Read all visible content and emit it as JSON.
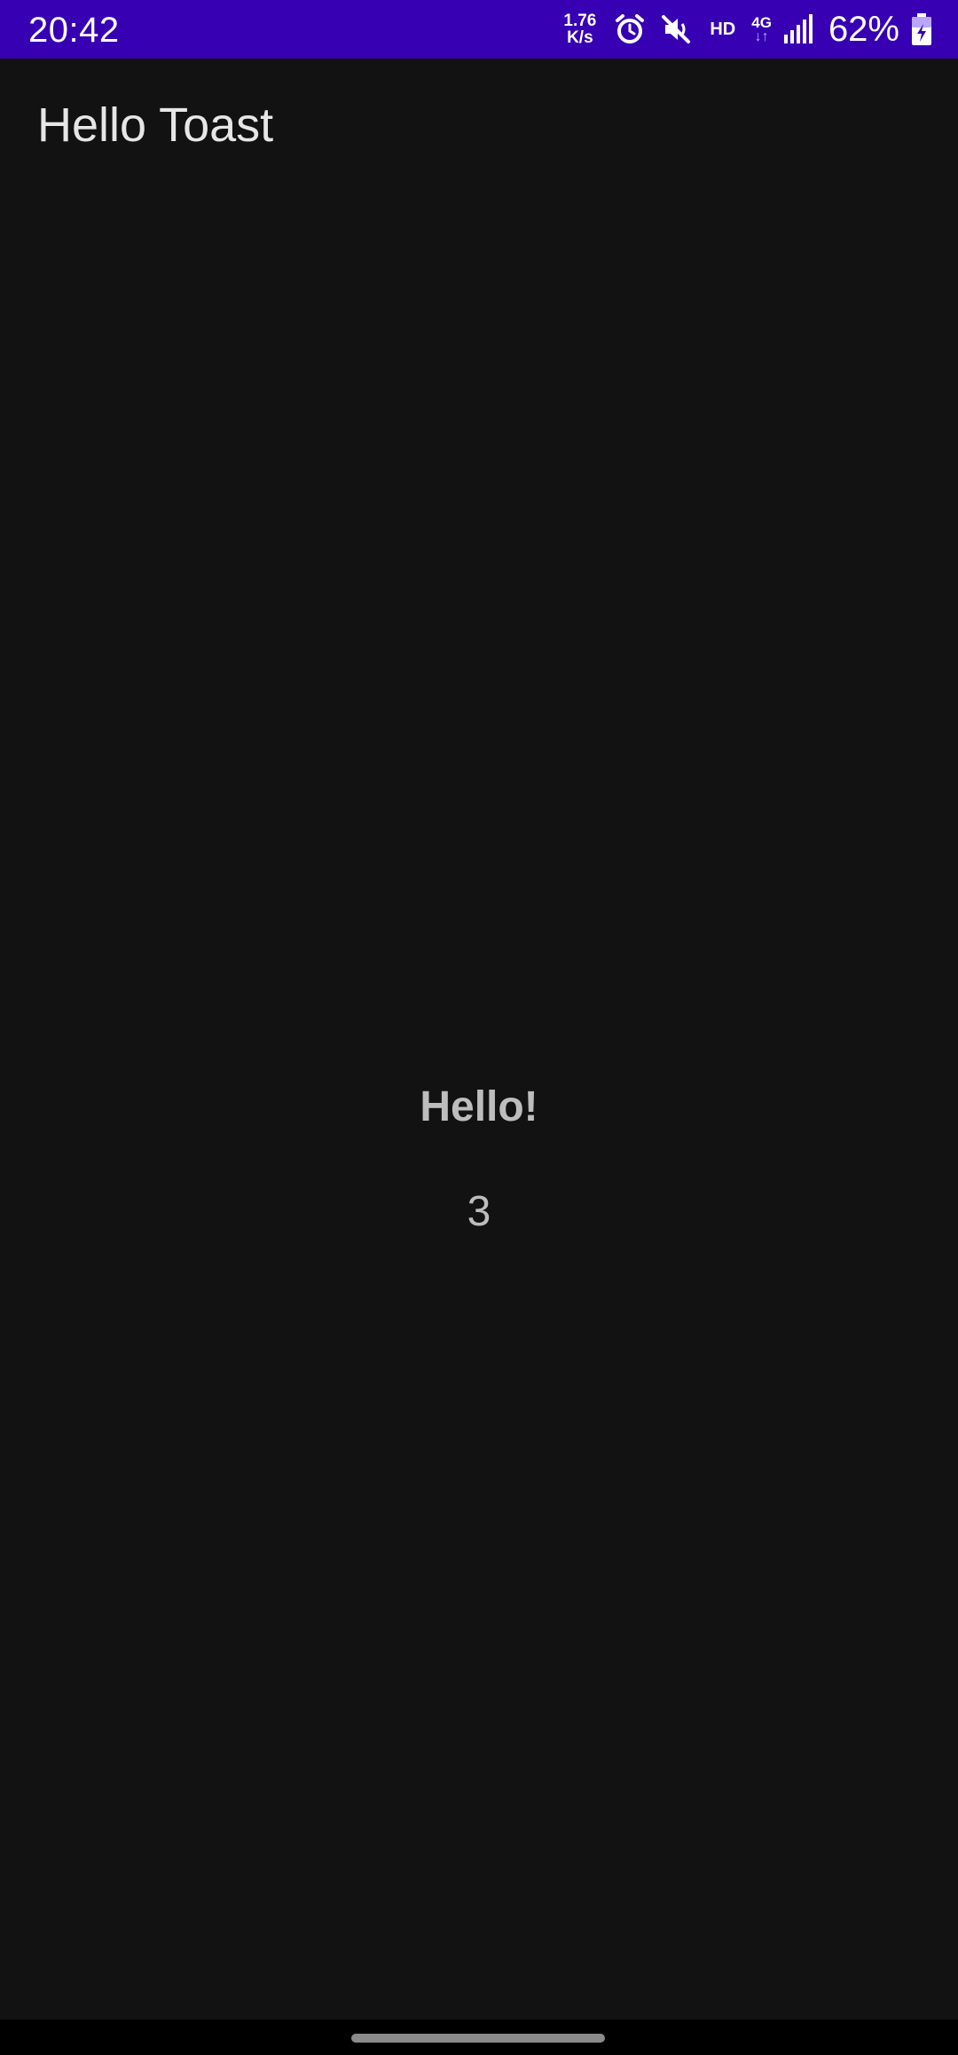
{
  "status_bar": {
    "time": "20:42",
    "net_speed_value": "1.76",
    "net_speed_unit": "K/s",
    "hd_label": "HD",
    "net_type": "4G",
    "battery_percent": "62%",
    "background_color": "#3700b3",
    "icons": [
      "alarm-icon",
      "mute-icon",
      "signal-icon",
      "battery-charging-icon"
    ]
  },
  "app_bar": {
    "title": "Hello Toast"
  },
  "main": {
    "hello_text": "Hello!",
    "count": "3"
  },
  "theme": {
    "background": "#121212",
    "text_primary": "#e6e6e6",
    "text_secondary": "#bdbdbd"
  }
}
